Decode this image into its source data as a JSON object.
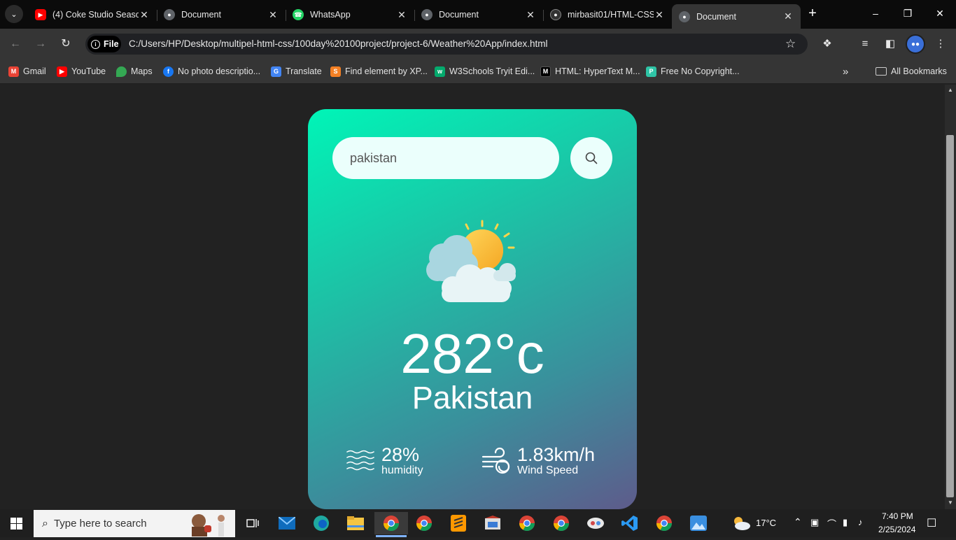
{
  "browser": {
    "tabs": [
      {
        "title": "(4) Coke Studio Season",
        "icon": "youtube-icon",
        "color": "#ff0000",
        "active": false
      },
      {
        "title": "Document",
        "icon": "globe-icon",
        "color": "#5f6368",
        "active": false
      },
      {
        "title": "WhatsApp",
        "icon": "whatsapp-icon",
        "color": "#25d366",
        "active": false
      },
      {
        "title": "Document",
        "icon": "globe-icon",
        "color": "#5f6368",
        "active": false
      },
      {
        "title": "mirbasit01/HTML-CSS",
        "icon": "github-icon",
        "color": "#333333",
        "active": false
      },
      {
        "title": "Document",
        "icon": "globe-icon",
        "color": "#5f6368",
        "active": true
      }
    ],
    "url_scheme_label": "File",
    "url": "C:/Users/HP/Desktop/multipel-html-css/100day%20100project/project-6/Weather%20App/index.html",
    "bookmarks": [
      {
        "label": "Gmail",
        "icon": "gmail-icon",
        "color": "#ea4335"
      },
      {
        "label": "YouTube",
        "icon": "youtube-icon",
        "color": "#ff0000"
      },
      {
        "label": "Maps",
        "icon": "maps-icon",
        "color": "#34a853"
      },
      {
        "label": "No photo descriptio...",
        "icon": "facebook-icon",
        "color": "#1877f2"
      },
      {
        "label": "Translate",
        "icon": "translate-icon",
        "color": "#4285f4"
      },
      {
        "label": "Find element by XP...",
        "icon": "stackoverflow-icon",
        "color": "#f48024"
      },
      {
        "label": "W3Schools Tryit Edi...",
        "icon": "w3schools-icon",
        "color": "#04aa6d"
      },
      {
        "label": "HTML: HyperText M...",
        "icon": "mdn-icon",
        "color": "#000000"
      },
      {
        "label": "Free No Copyright...",
        "icon": "pixabay-icon",
        "color": "#2ec4a6"
      }
    ],
    "all_bookmarks": "All Bookmarks"
  },
  "weather": {
    "search_value": "pakistan",
    "temperature": "282°c",
    "city": "Pakistan",
    "humidity_value": "28%",
    "humidity_label": "humidity",
    "wind_value": "1.83km/h",
    "wind_label": "Wind Speed",
    "condition_icon": "partly-cloudy-icon"
  },
  "taskbar": {
    "search_placeholder": "Type here to search",
    "weather_temp": "17°C",
    "time": "7:40 PM",
    "date": "2/25/2024"
  }
}
